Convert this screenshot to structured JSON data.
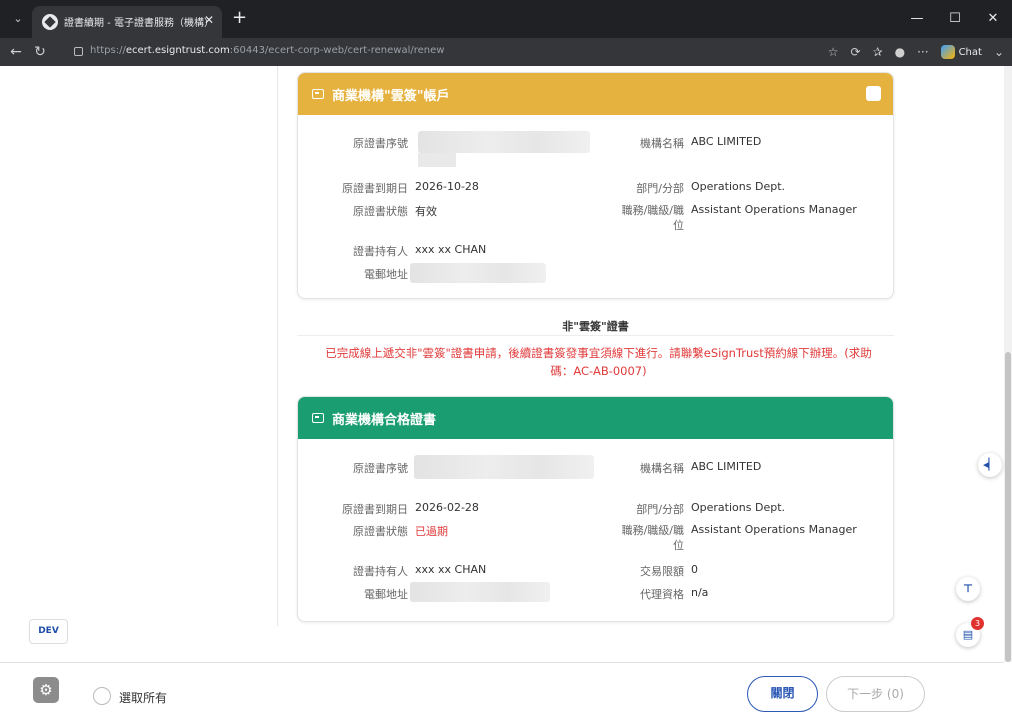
{
  "browser": {
    "tab_title": "證書續期 - 電子證書服務（機構）",
    "url_prefix": "https://",
    "url_host": "ecert.esigntrust.com",
    "url_path": ":60443/ecert-corp-web/cert-renewal/renew",
    "chat_label": "Chat"
  },
  "cloud_card": {
    "title": "商業機構\"雲簽\"帳戶",
    "labels": {
      "serial": "原證書序號",
      "expiry": "原證書到期日",
      "status": "原證書狀態",
      "holder": "證書持有人",
      "email": "電郵地址",
      "org": "機構名稱",
      "dept": "部門/分部",
      "position_1": "職務/職級/職",
      "position_2": "位"
    },
    "values": {
      "expiry": "2026-10-28",
      "status": "有效",
      "holder": "xxx xx CHAN",
      "org": "ABC LIMITED",
      "dept": "Operations Dept.",
      "position": "Assistant Operations Manager"
    }
  },
  "non_cloud": {
    "section_title": "非\"雲簽\"證書",
    "notice_line1": "已完成線上遞交非\"雲簽\"證書申請，後續證書簽發事宜須線下進行。請聯繫eSignTrust預約線下辦理。(求助",
    "notice_line2": "碼：AC-AB-0007)"
  },
  "qualified_card": {
    "title": "商業機構合格證書",
    "labels": {
      "serial": "原證書序號",
      "expiry": "原證書到期日",
      "status": "原證書狀態",
      "holder": "證書持有人",
      "email": "電郵地址",
      "org": "機構名稱",
      "dept": "部門/分部",
      "position_1": "職務/職級/職",
      "position_2": "位",
      "limit": "交易限額",
      "agent": "代理資格"
    },
    "values": {
      "expiry": "2026-02-28",
      "status": "已過期",
      "holder": "xxx xx CHAN",
      "org": "ABC LIMITED",
      "dept": "Operations Dept.",
      "position": "Assistant Operations Manager",
      "limit": "0",
      "agent": "n/a"
    }
  },
  "dev_badge": "DEV",
  "notification_count": "3",
  "footer": {
    "select_all": "選取所有",
    "close": "關閉",
    "next": "下一步 (0)"
  },
  "colors": {
    "gold_header": "#e6b23f",
    "green_header": "#1b9d72",
    "error_red": "#e03a3a",
    "primary_blue": "#2b57b5"
  }
}
